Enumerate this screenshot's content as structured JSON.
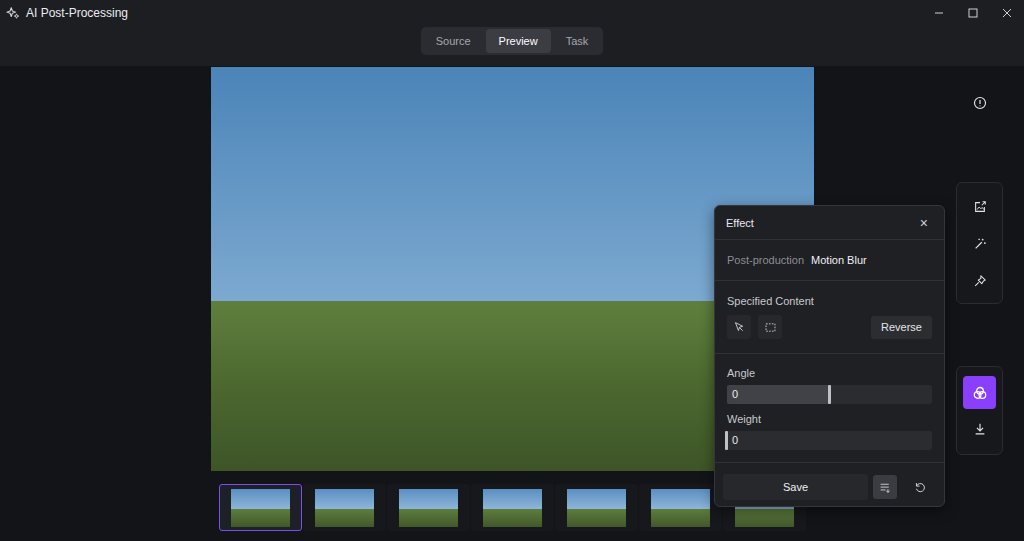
{
  "window": {
    "title": "AI Post-Processing"
  },
  "tabs": [
    {
      "label": "Source",
      "selected": false
    },
    {
      "label": "Preview",
      "selected": true
    },
    {
      "label": "Task",
      "selected": false
    }
  ],
  "thumbnails": [
    {
      "selected": true
    },
    {
      "selected": false
    },
    {
      "selected": false
    },
    {
      "selected": false
    },
    {
      "selected": false
    },
    {
      "selected": false
    },
    {
      "selected": false
    }
  ],
  "toolbar": {
    "groups": [
      [
        {
          "selected": false
        }
      ],
      [
        {
          "selected": false
        },
        {
          "selected": false
        },
        {
          "selected": false
        }
      ],
      [
        {
          "selected": true
        },
        {
          "selected": false
        }
      ]
    ]
  },
  "effect_panel": {
    "title": "Effect",
    "close": "×",
    "post_production": {
      "label": "Post-production",
      "value": "Motion Blur"
    },
    "specified_content": {
      "label": "Specified Content",
      "tools": [
        {
          "selected": false
        },
        {
          "selected": false
        }
      ],
      "reverse": "Reverse"
    },
    "sliders": [
      {
        "label": "Angle",
        "value": "0",
        "level": 0.5
      },
      {
        "label": "Weight",
        "value": "0",
        "level": 0
      }
    ],
    "save": "Save"
  }
}
